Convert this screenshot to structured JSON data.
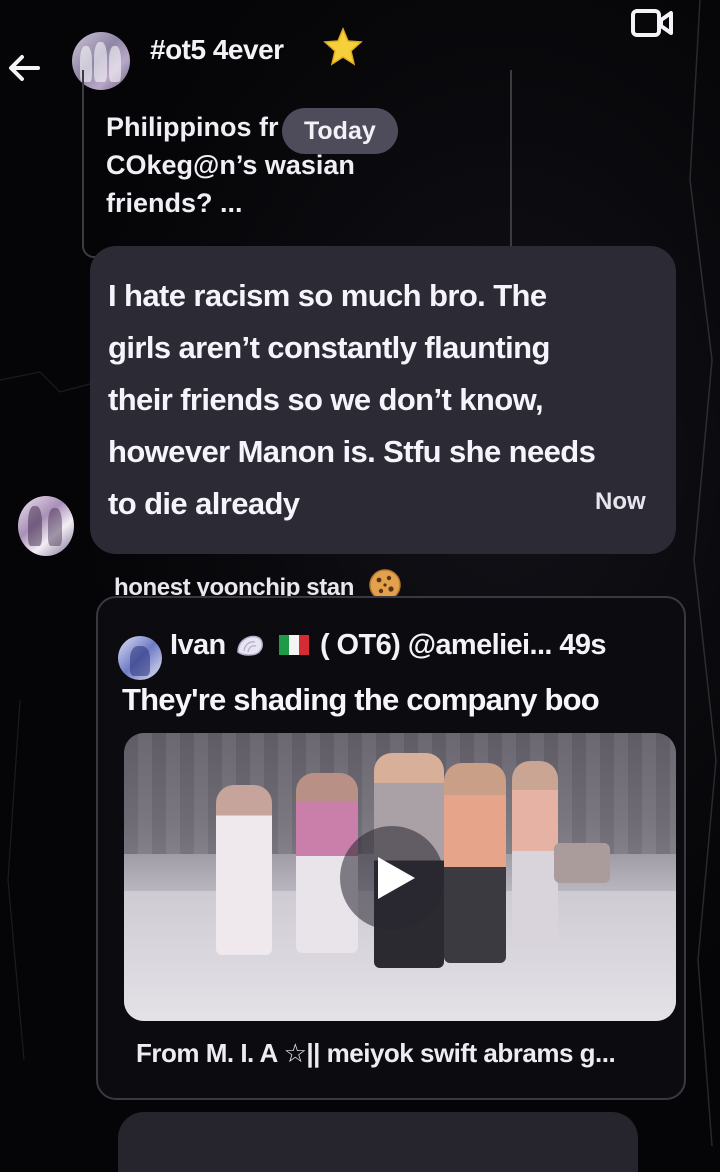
{
  "header": {
    "title": "#ot5 4ever",
    "back_icon": "arrow-left-icon",
    "video_icon": "video-call-icon"
  },
  "quoted_message": {
    "lines": [
      "Philippinos fr",
      "COkeg@n’s wasian",
      "friends? ..."
    ]
  },
  "date_separator": "Today",
  "received_message": {
    "lines": [
      "I hate racism so much bro. The",
      "girls aren’t constantly flaunting",
      "their friends so we don’t know,",
      "however Manon is. Stfu she needs",
      "to die already"
    ],
    "time": "Now"
  },
  "shared_post": {
    "sender_name": "honest yoonchip stan",
    "author_name": "Ivan",
    "author_tag": "( OT6)",
    "handle": "@ameliei...",
    "age": "49s",
    "text": "They're shading the company boo",
    "caption": "From M. I. A ☆|| meiyok swift abrams g..."
  },
  "colors": {
    "background": "#050507",
    "bubble": "#2c2a35",
    "card_border": "#3a3942",
    "text": "#f6f4fa"
  }
}
